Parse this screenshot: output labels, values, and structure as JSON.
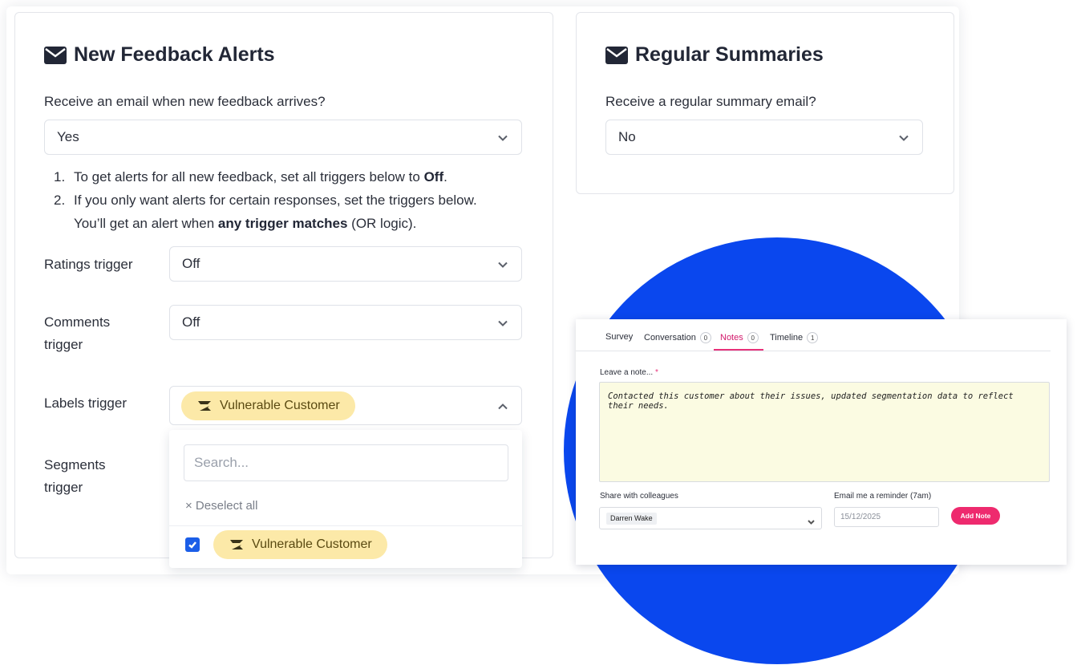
{
  "alerts": {
    "title": "New Feedback Alerts",
    "question": "Receive an email when new feedback arrives?",
    "selected": "Yes",
    "instructions": {
      "item1_num": "1.",
      "item1_text": "To get alerts for all new feedback, set all triggers below to ",
      "item1_bold": "Off",
      "item1_end": ".",
      "item2_num": "2.",
      "item2_text": "If you only want alerts for certain responses, set the triggers below.",
      "item2_line2_start": "You’ll get an alert when ",
      "item2_line2_bold": "any trigger matches",
      "item2_line2_end": " (OR logic)."
    },
    "triggers": {
      "ratings_label": "Ratings trigger",
      "ratings_value": "Off",
      "comments_label_1": "Comments",
      "comments_label_2": "trigger",
      "comments_value": "Off",
      "labels_label": "Labels trigger",
      "labels_chip": "Vulnerable Customer",
      "segments_label_1": "Segments",
      "segments_label_2": "trigger"
    },
    "dropdown": {
      "search_placeholder": "Search...",
      "deselect_all": "× Deselect all",
      "option_label": "Vulnerable Customer",
      "option_checked": true
    }
  },
  "summaries": {
    "title": "Regular Summaries",
    "question": "Receive a regular summary email?",
    "selected": "No"
  },
  "notes": {
    "tabs": [
      {
        "label": "Survey"
      },
      {
        "label": "Conversation",
        "count": "0"
      },
      {
        "label": "Notes",
        "count": "0",
        "active": true
      },
      {
        "label": "Timeline",
        "count": "1"
      }
    ],
    "note_label": "Leave a note...",
    "required_mark": "*",
    "note_text": "Contacted this customer about their issues, updated segmentation data to reflect their needs.",
    "share_label": "Share with colleagues",
    "share_user": "Darren Wake",
    "email_label": "Email me a reminder (7am)",
    "reminder_date": "15/12/2025",
    "add_button": "Add Note"
  },
  "colors": {
    "accent_blue": "#0a47ee",
    "accent_pink": "#ee2a6e",
    "chip_yellow": "#fce9a8"
  },
  "icons": [
    "envelope-icon",
    "chevron-down-icon",
    "chevron-up-icon",
    "label-tag-icon",
    "checkmark-icon"
  ]
}
